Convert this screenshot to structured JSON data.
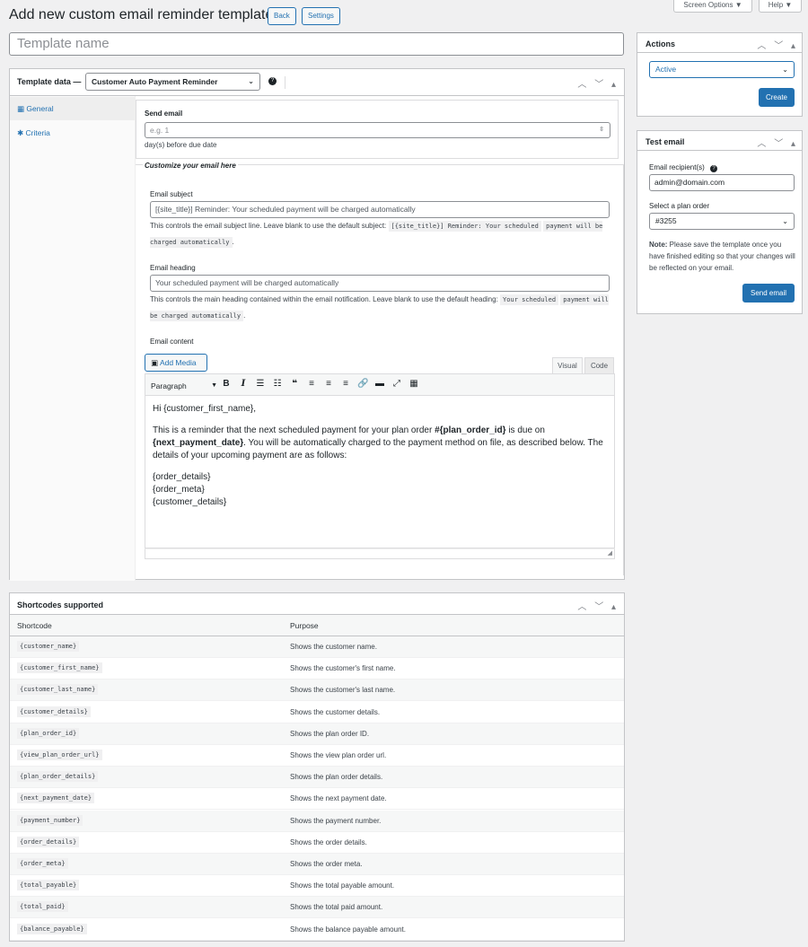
{
  "header": {
    "title": "Add new custom email reminder template",
    "back_label": "Back",
    "settings_label": "Settings",
    "screen_options_label": "Screen Options ▼",
    "help_label": "Help ▼"
  },
  "template_name": {
    "placeholder": "Template name"
  },
  "template_data": {
    "title": "Template data —",
    "selected": "Customer Auto Payment Reminder",
    "tabs": [
      {
        "label": "General"
      },
      {
        "label": "Criteria"
      }
    ],
    "send_email": {
      "label": "Send email",
      "placeholder": "e.g. 1",
      "help": "day(s) before due date"
    },
    "customize_legend": "Customize your email here",
    "subject": {
      "label": "Email subject",
      "value": "[{site_title}] Reminder: Your scheduled payment will be charged automatically",
      "desc": "This controls the email subject line. Leave blank to use the default subject:",
      "code_a": "[{site_title}] Reminder: Your scheduled",
      "code_b": "payment will be charged automatically",
      "end": "."
    },
    "heading": {
      "label": "Email heading",
      "value": "Your scheduled payment will be charged automatically",
      "desc": "This controls the main heading contained within the email notification. Leave blank to use the default heading:",
      "code_a": "Your scheduled",
      "code_b": "payment will be charged automatically",
      "end": "."
    },
    "content": {
      "label": "Email content",
      "add_media": "Add Media",
      "tab_visual": "Visual",
      "tab_code": "Code",
      "format": "Paragraph",
      "line1": "Hi {customer_first_name},",
      "p2_a": "This is a reminder that the next scheduled payment for your plan order ",
      "p2_b": "#{plan_order_id}",
      "p2_c": " is due on",
      "p2_d": "{next_payment_date}",
      "p2_e": ". You will be automatically charged to the payment method on file, as described below. The details of your upcoming payment are as follows:",
      "line_a": "{order_details}",
      "line_b": "{order_meta}",
      "line_c": "{customer_details}"
    }
  },
  "actions": {
    "title": "Actions",
    "status": "Active",
    "create_label": "Create"
  },
  "test_email": {
    "title": "Test email",
    "recipient_label": "Email recipient(s)",
    "recipient_value": "admin@domain.com",
    "order_label": "Select a plan order",
    "order_value": "#3255",
    "note_bold": "Note:",
    "note_text": " Please save the template once you have finished editing so that your changes will be reflected on your email.",
    "send_label": "Send email"
  },
  "shortcodes": {
    "title": "Shortcodes supported",
    "col1": "Shortcode",
    "col2": "Purpose",
    "rows": [
      {
        "code": "{customer_name}",
        "purpose": "Shows the customer name."
      },
      {
        "code": "{customer_first_name}",
        "purpose": "Shows the customer's first name."
      },
      {
        "code": "{customer_last_name}",
        "purpose": "Shows the customer's last name."
      },
      {
        "code": "{customer_details}",
        "purpose": "Shows the customer details."
      },
      {
        "code": "{plan_order_id}",
        "purpose": "Shows the plan order ID."
      },
      {
        "code": "{view_plan_order_url}",
        "purpose": "Shows the view plan order url."
      },
      {
        "code": "{plan_order_details}",
        "purpose": "Shows the plan order details."
      },
      {
        "code": "{next_payment_date}",
        "purpose": "Shows the next payment date."
      },
      {
        "code": "{payment_number}",
        "purpose": "Shows the payment number."
      },
      {
        "code": "{order_details}",
        "purpose": "Shows the order details."
      },
      {
        "code": "{order_meta}",
        "purpose": "Shows the order meta."
      },
      {
        "code": "{total_payable}",
        "purpose": "Shows the total payable amount."
      },
      {
        "code": "{total_paid}",
        "purpose": "Shows the total paid amount."
      },
      {
        "code": "{balance_payable}",
        "purpose": "Shows the balance payable amount."
      }
    ]
  },
  "colors": {
    "accent": "#2271b1",
    "border": "#c3c4c7",
    "bg": "#f0f0f1"
  }
}
